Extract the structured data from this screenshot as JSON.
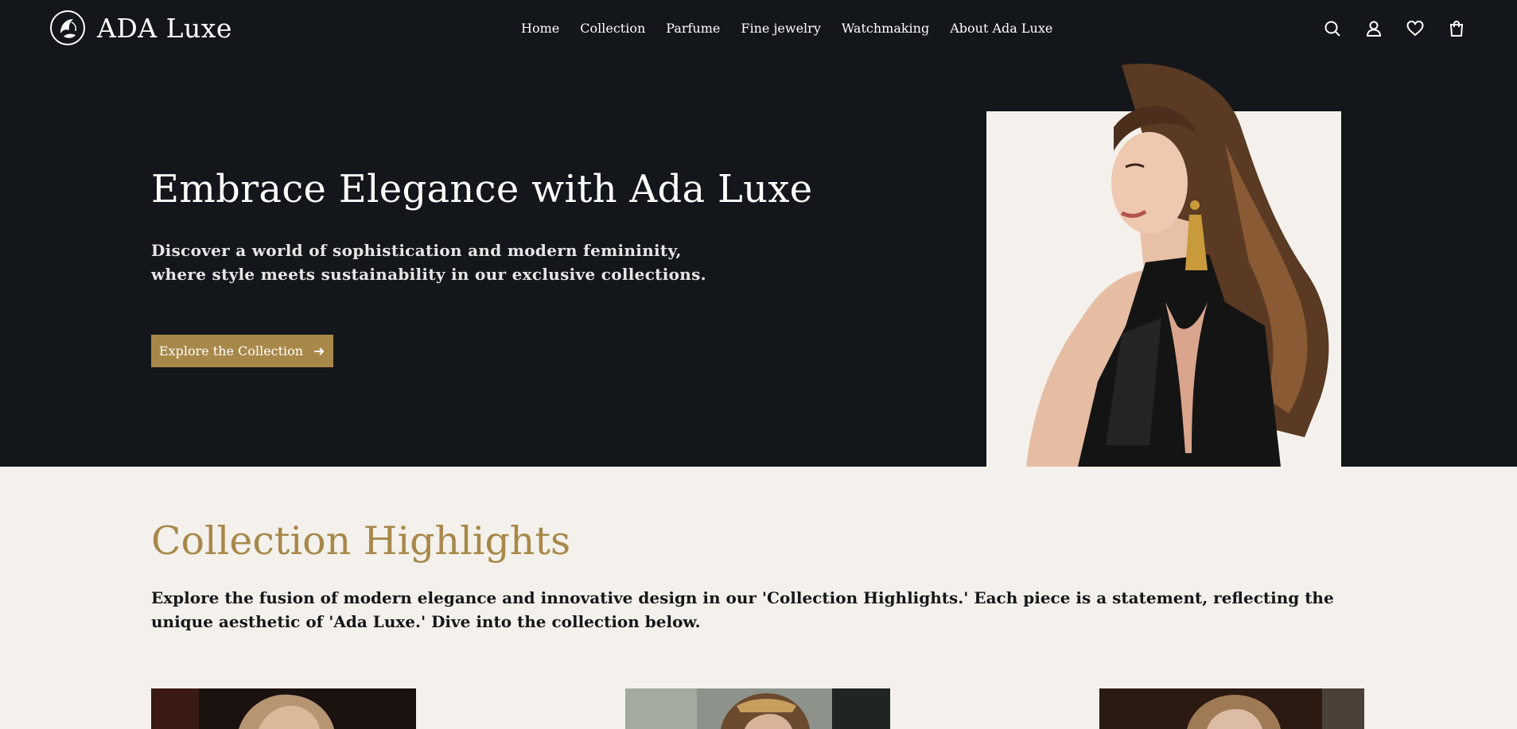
{
  "brand": {
    "name": "ADA Luxe",
    "logo_icon": "flower-emblem-icon"
  },
  "nav": {
    "items": [
      {
        "label": "Home"
      },
      {
        "label": "Collection"
      },
      {
        "label": "Parfume"
      },
      {
        "label": "Fine jewelry"
      },
      {
        "label": "Watchmaking"
      },
      {
        "label": "About Ada Luxe"
      }
    ]
  },
  "header_icons": [
    "search-icon",
    "user-icon",
    "heart-icon",
    "shopping-bag-icon"
  ],
  "hero": {
    "title": "Embrace Elegance with Ada Luxe",
    "subtitle": "Discover a world of sophistication and modern femininity, where style meets sustainability in our exclusive collections.",
    "cta_label": "Explore the Collection",
    "cta_icon": "arrow-right-icon",
    "image_alt": "woman-in-black-halter-dress-portrait"
  },
  "highlights": {
    "title": "Collection Highlights",
    "description": "Explore the fusion of modern elegance and innovative design in our 'Collection Highlights.' Each piece is a statement, reflecting the unique aesthetic of 'Ada Luxe.' Dive into the collection below."
  },
  "colors": {
    "dark_bg": "#13161a",
    "accent_gold": "#a88849",
    "light_bg": "#f4f1ec",
    "text_dark": "#15171a",
    "text_light": "#ffffff"
  }
}
